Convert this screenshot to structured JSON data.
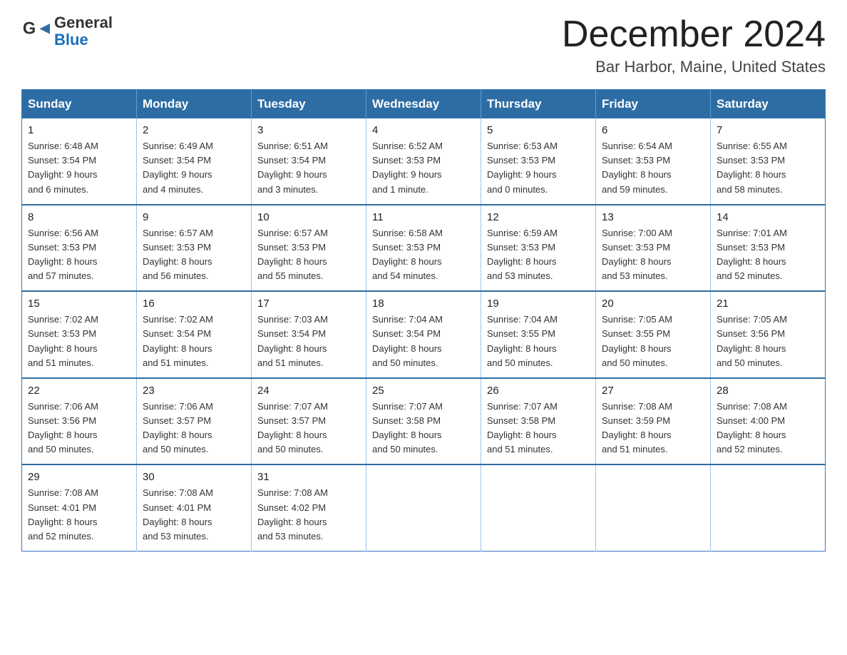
{
  "header": {
    "logo_general": "General",
    "logo_blue": "Blue",
    "month": "December 2024",
    "location": "Bar Harbor, Maine, United States"
  },
  "weekdays": [
    "Sunday",
    "Monday",
    "Tuesday",
    "Wednesday",
    "Thursday",
    "Friday",
    "Saturday"
  ],
  "weeks": [
    [
      {
        "day": "1",
        "sunrise": "6:48 AM",
        "sunset": "3:54 PM",
        "daylight": "9 hours and 6 minutes."
      },
      {
        "day": "2",
        "sunrise": "6:49 AM",
        "sunset": "3:54 PM",
        "daylight": "9 hours and 4 minutes."
      },
      {
        "day": "3",
        "sunrise": "6:51 AM",
        "sunset": "3:54 PM",
        "daylight": "9 hours and 3 minutes."
      },
      {
        "day": "4",
        "sunrise": "6:52 AM",
        "sunset": "3:53 PM",
        "daylight": "9 hours and 1 minute."
      },
      {
        "day": "5",
        "sunrise": "6:53 AM",
        "sunset": "3:53 PM",
        "daylight": "9 hours and 0 minutes."
      },
      {
        "day": "6",
        "sunrise": "6:54 AM",
        "sunset": "3:53 PM",
        "daylight": "8 hours and 59 minutes."
      },
      {
        "day": "7",
        "sunrise": "6:55 AM",
        "sunset": "3:53 PM",
        "daylight": "8 hours and 58 minutes."
      }
    ],
    [
      {
        "day": "8",
        "sunrise": "6:56 AM",
        "sunset": "3:53 PM",
        "daylight": "8 hours and 57 minutes."
      },
      {
        "day": "9",
        "sunrise": "6:57 AM",
        "sunset": "3:53 PM",
        "daylight": "8 hours and 56 minutes."
      },
      {
        "day": "10",
        "sunrise": "6:57 AM",
        "sunset": "3:53 PM",
        "daylight": "8 hours and 55 minutes."
      },
      {
        "day": "11",
        "sunrise": "6:58 AM",
        "sunset": "3:53 PM",
        "daylight": "8 hours and 54 minutes."
      },
      {
        "day": "12",
        "sunrise": "6:59 AM",
        "sunset": "3:53 PM",
        "daylight": "8 hours and 53 minutes."
      },
      {
        "day": "13",
        "sunrise": "7:00 AM",
        "sunset": "3:53 PM",
        "daylight": "8 hours and 53 minutes."
      },
      {
        "day": "14",
        "sunrise": "7:01 AM",
        "sunset": "3:53 PM",
        "daylight": "8 hours and 52 minutes."
      }
    ],
    [
      {
        "day": "15",
        "sunrise": "7:02 AM",
        "sunset": "3:53 PM",
        "daylight": "8 hours and 51 minutes."
      },
      {
        "day": "16",
        "sunrise": "7:02 AM",
        "sunset": "3:54 PM",
        "daylight": "8 hours and 51 minutes."
      },
      {
        "day": "17",
        "sunrise": "7:03 AM",
        "sunset": "3:54 PM",
        "daylight": "8 hours and 51 minutes."
      },
      {
        "day": "18",
        "sunrise": "7:04 AM",
        "sunset": "3:54 PM",
        "daylight": "8 hours and 50 minutes."
      },
      {
        "day": "19",
        "sunrise": "7:04 AM",
        "sunset": "3:55 PM",
        "daylight": "8 hours and 50 minutes."
      },
      {
        "day": "20",
        "sunrise": "7:05 AM",
        "sunset": "3:55 PM",
        "daylight": "8 hours and 50 minutes."
      },
      {
        "day": "21",
        "sunrise": "7:05 AM",
        "sunset": "3:56 PM",
        "daylight": "8 hours and 50 minutes."
      }
    ],
    [
      {
        "day": "22",
        "sunrise": "7:06 AM",
        "sunset": "3:56 PM",
        "daylight": "8 hours and 50 minutes."
      },
      {
        "day": "23",
        "sunrise": "7:06 AM",
        "sunset": "3:57 PM",
        "daylight": "8 hours and 50 minutes."
      },
      {
        "day": "24",
        "sunrise": "7:07 AM",
        "sunset": "3:57 PM",
        "daylight": "8 hours and 50 minutes."
      },
      {
        "day": "25",
        "sunrise": "7:07 AM",
        "sunset": "3:58 PM",
        "daylight": "8 hours and 50 minutes."
      },
      {
        "day": "26",
        "sunrise": "7:07 AM",
        "sunset": "3:58 PM",
        "daylight": "8 hours and 51 minutes."
      },
      {
        "day": "27",
        "sunrise": "7:08 AM",
        "sunset": "3:59 PM",
        "daylight": "8 hours and 51 minutes."
      },
      {
        "day": "28",
        "sunrise": "7:08 AM",
        "sunset": "4:00 PM",
        "daylight": "8 hours and 52 minutes."
      }
    ],
    [
      {
        "day": "29",
        "sunrise": "7:08 AM",
        "sunset": "4:01 PM",
        "daylight": "8 hours and 52 minutes."
      },
      {
        "day": "30",
        "sunrise": "7:08 AM",
        "sunset": "4:01 PM",
        "daylight": "8 hours and 53 minutes."
      },
      {
        "day": "31",
        "sunrise": "7:08 AM",
        "sunset": "4:02 PM",
        "daylight": "8 hours and 53 minutes."
      },
      null,
      null,
      null,
      null
    ]
  ],
  "labels": {
    "sunrise": "Sunrise: ",
    "sunset": "Sunset: ",
    "daylight": "Daylight: "
  }
}
